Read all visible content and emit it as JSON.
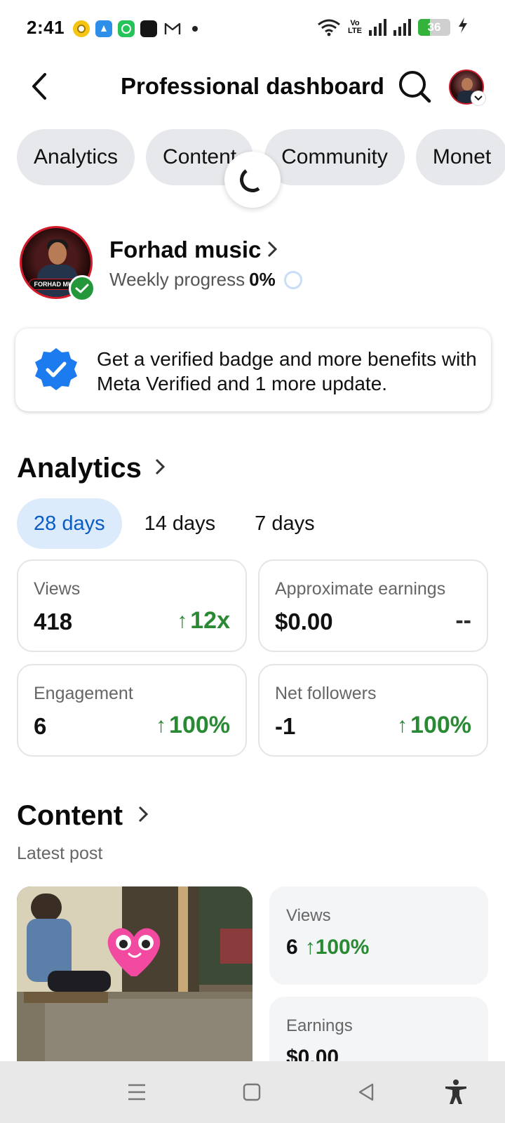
{
  "status_bar": {
    "time": "2:41",
    "volte_line1": "Vo",
    "volte_line2": "LTE",
    "battery_percent": "36",
    "battery_level": 0.36
  },
  "header": {
    "title": "Professional dashboard",
    "back_icon": "back-arrow-icon",
    "search_icon": "search-icon"
  },
  "tabs": [
    "Analytics",
    "Content",
    "Community",
    "Monet"
  ],
  "profile": {
    "name": "Forhad music",
    "picture_tag": "FORHAD MU",
    "weekly_label": "Weekly progress",
    "weekly_value": "0%",
    "weekly_progress": 0
  },
  "promo": {
    "text": "Get a verified badge and more benefits with Meta Verified and 1 more update."
  },
  "analytics": {
    "title": "Analytics",
    "ranges": [
      "28 days",
      "14 days",
      "7 days"
    ],
    "selected_range": "28 days",
    "cards": [
      {
        "label": "Views",
        "value": "418",
        "change": "12x",
        "trend": "up"
      },
      {
        "label": "Approximate earnings",
        "value": "$0.00",
        "change": "--",
        "trend": "none"
      },
      {
        "label": "Engagement",
        "value": "6",
        "change": "100%",
        "trend": "up"
      },
      {
        "label": "Net followers",
        "value": "-1",
        "change": "100%",
        "trend": "up"
      }
    ]
  },
  "content": {
    "title": "Content",
    "subtitle": "Latest post",
    "post_stats": [
      {
        "label": "Views",
        "value": "6",
        "change": "100%"
      },
      {
        "label": "Earnings",
        "value": "$0.00"
      }
    ]
  },
  "colors": {
    "accent_blue": "#0a5cc2",
    "positive_green": "#2a8a34",
    "chip_bg": "#e6e8eb",
    "active_range_bg": "#dcebfc"
  }
}
